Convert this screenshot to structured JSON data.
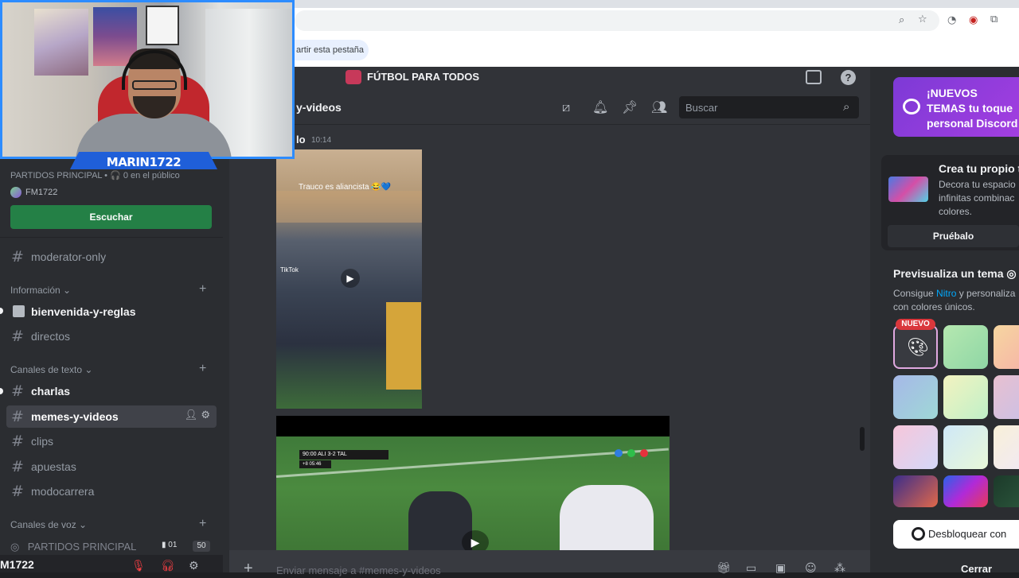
{
  "browser": {
    "share_tab_label": "artir esta pestaña",
    "icons": [
      "zoom-icon",
      "star-icon",
      "extension-icon",
      "profile-icon",
      "puzzle-icon"
    ]
  },
  "server": {
    "name": "FÚTBOL PARA TODOS"
  },
  "channel": {
    "title": "y-videos",
    "search_placeholder": "Buscar",
    "input_placeholder": "Enviar mensaje a #memes-y-videos"
  },
  "message": {
    "author": "lo",
    "time": "10:14",
    "video1_caption": "Trauco es aliancista 😂💙",
    "video1_watermark": "TikTok",
    "video2_scorebug": "90:00  ALI  3-2  TAL",
    "video2_clock": "+8  05:46"
  },
  "sidebar": {
    "stage_line": "PARTIDOS PRINCIPAL • 🎧 0 en el público",
    "stage_user": "FM1722",
    "listen_button": "Escuchar",
    "channels_top": [
      {
        "name": "moderator-only"
      }
    ],
    "categories": {
      "info": "Información ⌄",
      "text": "Canales de texto ⌄",
      "voice": "Canales de voz ⌄"
    },
    "info_channels": [
      {
        "name": "bienvenida-y-reglas"
      },
      {
        "name": "directos"
      }
    ],
    "text_channels": [
      {
        "name": "charlas"
      },
      {
        "name": "memes-y-videos"
      },
      {
        "name": "clips"
      },
      {
        "name": "apuestas"
      },
      {
        "name": "modocarrera"
      }
    ],
    "voice_channel": {
      "name": "PARTIDOS PRINCIPAL",
      "count": "01",
      "limit": "50"
    },
    "user_name": "M1722"
  },
  "webcam": {
    "name": "MARIN1722"
  },
  "right_panel": {
    "nitro_banner": "¡NUEVOS TEMAS tu toque personal Discord",
    "create_title": "Crea tu propio t",
    "create_desc": "Decora tu espacio infinitas combinac colores.",
    "try_button": "Pruébalo",
    "preview_title": "Previsualiza un tema",
    "preview_desc_pre": "Consigue ",
    "preview_desc_link": "Nitro",
    "preview_desc_post": " y personaliza con colores únicos.",
    "new_badge": "NUEVO",
    "unlock_button": "Desbloquear con",
    "close_button": "Cerrar",
    "swatch_colors": [
      "linear-gradient(135deg,#b5e8b0,#8fd6a5)",
      "linear-gradient(135deg,#f6d6a0,#f6b0a8)",
      "linear-gradient(135deg,#a6b8e8,#9fd8d6)",
      "linear-gradient(135deg,#f3f3c0,#c0f0c8)",
      "linear-gradient(135deg,#e8c0d0,#c8c0e8)",
      "linear-gradient(135deg,#f7c6da,#d4d8f8)",
      "linear-gradient(135deg,#cfe8f8,#e8f8d8)",
      "linear-gradient(135deg,#f8f0d8,#f0e8f8)",
      "linear-gradient(135deg,#3b2d8a,#e0684a)",
      "linear-gradient(135deg,#2a62e8,#b02ad8,#e83a5a)",
      "linear-gradient(135deg,#1c3a2a,#2d5a3e)"
    ]
  }
}
